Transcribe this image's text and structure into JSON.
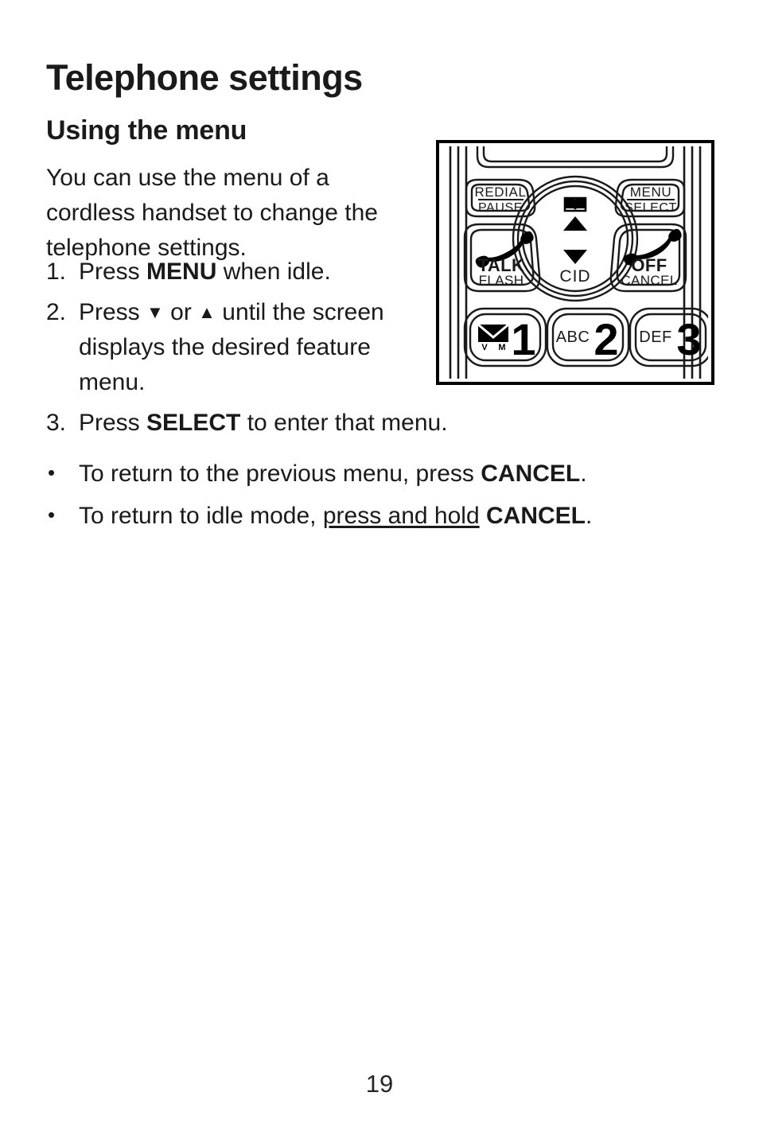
{
  "document": {
    "chapter_title": "Telephone settings",
    "section_title": "Using the menu",
    "page_number": "19"
  },
  "intro": {
    "text": "You can use the menu of a cordless handset to change the telephone settings."
  },
  "steps": [
    {
      "marker": "1.",
      "parts": [
        {
          "text": "Press ",
          "style": "normal"
        },
        {
          "text": "MENU",
          "style": "bold"
        },
        {
          "text": " when idle.",
          "style": "normal"
        }
      ],
      "plain": "1. Press MENU when idle."
    },
    {
      "marker": "2.",
      "parts": [
        {
          "text": "Press ",
          "style": "normal"
        },
        {
          "text": "▼",
          "style": "glyph"
        },
        {
          "text": " or ",
          "style": "normal"
        },
        {
          "text": "▲",
          "style": "glyph"
        },
        {
          "text": " until the screen displays the desired feature menu.",
          "style": "normal"
        }
      ],
      "plain": "2. Press ▼ or ▲ until the screen displays the desired feature menu."
    },
    {
      "marker": "3.",
      "parts": [
        {
          "text": "Press ",
          "style": "normal"
        },
        {
          "text": "SELECT",
          "style": "bold"
        },
        {
          "text": " to enter that menu.",
          "style": "normal"
        }
      ],
      "plain": "3. Press SELECT to enter that menu."
    }
  ],
  "step_fragments": {
    "s1_pre": "Press ",
    "s1_bold": "MENU",
    "s1_post": " when idle.",
    "s2_pre": "Press ",
    "s2_down": "▼",
    "s2_mid": " or ",
    "s2_up": "▲",
    "s2_post": " until the screen displays the desired feature menu.",
    "s3_pre": "Press ",
    "s3_bold": "SELECT",
    "s3_post": " to enter that menu."
  },
  "bullets": [
    {
      "marker": "•",
      "plain": "To return to the previous menu, press CANCEL."
    },
    {
      "marker": "•",
      "plain": "To return to idle mode, press and hold CANCEL."
    }
  ],
  "bullet_fragments": {
    "b1_pre": "To return to the previous menu, press ",
    "b1_bold": "CANCEL",
    "b1_post": ".",
    "b2_pre": "To return to idle mode, ",
    "b2_underline": "press and hold",
    "b2_mid": " ",
    "b2_bold": "CANCEL",
    "b2_post": "."
  },
  "figure": {
    "name": "cordless-handset-keypad-illustration",
    "description": "Line drawing of the upper keypad of a cordless handset",
    "buttons": {
      "redial": {
        "line1": "REDIAL",
        "line2": "PAUSE"
      },
      "menu": {
        "line1": "MENU",
        "line2": "SELECT"
      },
      "talk": {
        "line1": "TALK",
        "line2": "FLASH",
        "icon": "handset-off-hook-icon"
      },
      "off": {
        "line1": "OFF",
        "line2": "CANCEL",
        "icon": "handset-on-hook-icon"
      },
      "nav": {
        "top_icon": "phonebook-icon",
        "up": "▲",
        "down": "▼",
        "bottom_label": "CID"
      },
      "key1": {
        "digit": "1",
        "letters": "",
        "icon": "voicemail-envelope-icon",
        "icon_label": "VM"
      },
      "key2": {
        "digit": "2",
        "letters": "ABC"
      },
      "key3": {
        "digit": "3",
        "letters": "DEF"
      }
    }
  },
  "colors": {
    "ink": "#1a1a1a",
    "page_background": "#ffffff",
    "figure_line": "#000000"
  }
}
